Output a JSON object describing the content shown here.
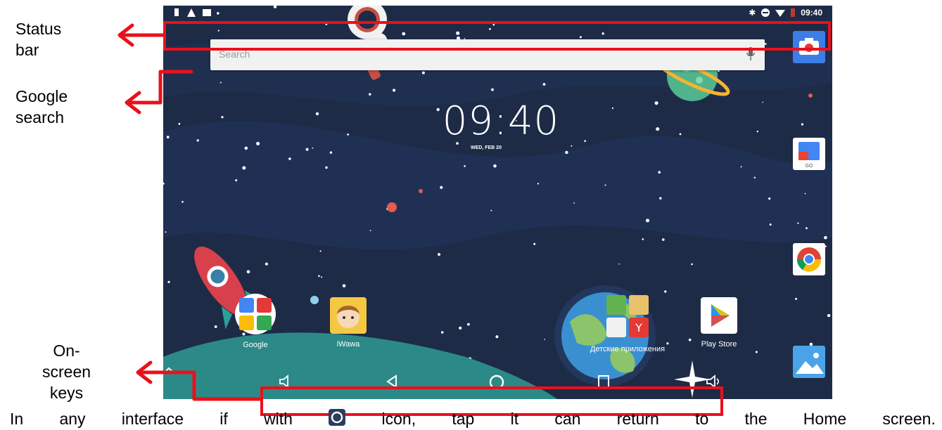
{
  "annotations": {
    "status_bar": [
      "Status",
      "bar"
    ],
    "google_search": [
      "Google",
      "search"
    ],
    "onscreen_keys": [
      "On-",
      "screen",
      "keys"
    ]
  },
  "status": {
    "time": "09:40"
  },
  "search": {
    "placeholder": "Search"
  },
  "clock": {
    "time": "09:40",
    "date": "WED, FEB 20"
  },
  "apps": [
    {
      "label": "Google",
      "icon": "google-folder-icon"
    },
    {
      "label": "iWawa",
      "icon": "iwawa-icon"
    },
    {
      "label": "Детские приложения",
      "icon": "kids-apps-folder-icon"
    },
    {
      "label": "Play Store",
      "icon": "play-store-icon"
    }
  ],
  "dock": [
    {
      "icon": "camera-icon"
    },
    {
      "icon": "google-go-icon",
      "text": "GO"
    },
    {
      "icon": "chrome-icon"
    },
    {
      "icon": "gallery-icon"
    }
  ],
  "caption": {
    "words": [
      "In",
      "any",
      "interface",
      "if",
      "with",
      "icon,",
      "tap",
      "it",
      "can",
      "return",
      "to",
      "the",
      "Home",
      "screen."
    ]
  },
  "colors": {
    "annotation": "#e8111b",
    "sky": "#1d2b47",
    "planet": "#3a8fd1"
  }
}
